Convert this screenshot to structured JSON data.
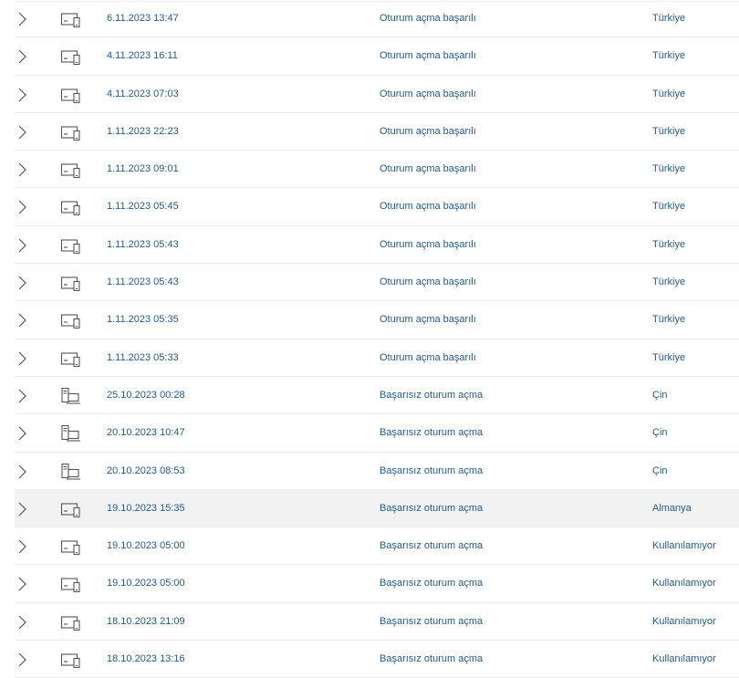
{
  "colors": {
    "link": "#1f5b96",
    "icon": "#555555",
    "row_hover": "#f2f2f2",
    "divider": "#ececec"
  },
  "rows": [
    {
      "date": "6.11.2023 13:47",
      "result": "Oturum açma başarılı",
      "country": "Türkiye",
      "device": "laptop-phone-icon"
    },
    {
      "date": "4.11.2023 16:11",
      "result": "Oturum açma başarılı",
      "country": "Türkiye",
      "device": "laptop-phone-icon"
    },
    {
      "date": "4.11.2023 07:03",
      "result": "Oturum açma başarılı",
      "country": "Türkiye",
      "device": "laptop-phone-icon"
    },
    {
      "date": "1.11.2023 22:23",
      "result": "Oturum açma başarılı",
      "country": "Türkiye",
      "device": "laptop-phone-icon"
    },
    {
      "date": "1.11.2023 09:01",
      "result": "Oturum açma başarılı",
      "country": "Türkiye",
      "device": "laptop-phone-icon"
    },
    {
      "date": "1.11.2023 05:45",
      "result": "Oturum açma başarılı",
      "country": "Türkiye",
      "device": "laptop-phone-icon"
    },
    {
      "date": "1.11.2023 05:43",
      "result": "Oturum açma başarılı",
      "country": "Türkiye",
      "device": "laptop-phone-icon"
    },
    {
      "date": "1.11.2023 05:43",
      "result": "Oturum açma başarılı",
      "country": "Türkiye",
      "device": "laptop-phone-icon"
    },
    {
      "date": "1.11.2023 05:35",
      "result": "Oturum açma başarılı",
      "country": "Türkiye",
      "device": "laptop-phone-icon"
    },
    {
      "date": "1.11.2023 05:33",
      "result": "Oturum açma başarılı",
      "country": "Türkiye",
      "device": "laptop-phone-icon"
    },
    {
      "date": "25.10.2023 00:28",
      "result": "Başarısız oturum açma",
      "country": "Çin",
      "device": "desktop-tower-icon"
    },
    {
      "date": "20.10.2023 10:47",
      "result": "Başarısız oturum açma",
      "country": "Çin",
      "device": "desktop-tower-icon"
    },
    {
      "date": "20.10.2023 08:53",
      "result": "Başarısız oturum açma",
      "country": "Çin",
      "device": "desktop-tower-icon"
    },
    {
      "date": "19.10.2023 15:35",
      "result": "Başarısız oturum açma",
      "country": "Almanya",
      "device": "laptop-phone-icon",
      "highlighted": true
    },
    {
      "date": "19.10.2023 05:00",
      "result": "Başarısız oturum açma",
      "country": "Kullanılamıyor",
      "device": "laptop-phone-icon"
    },
    {
      "date": "19.10.2023 05:00",
      "result": "Başarısız oturum açma",
      "country": "Kullanılamıyor",
      "device": "laptop-phone-icon"
    },
    {
      "date": "18.10.2023 21:09",
      "result": "Başarısız oturum açma",
      "country": "Kullanılamıyor",
      "device": "laptop-phone-icon"
    },
    {
      "date": "18.10.2023 13:16",
      "result": "Başarısız oturum açma",
      "country": "Kullanılamıyor",
      "device": "laptop-phone-icon"
    }
  ]
}
